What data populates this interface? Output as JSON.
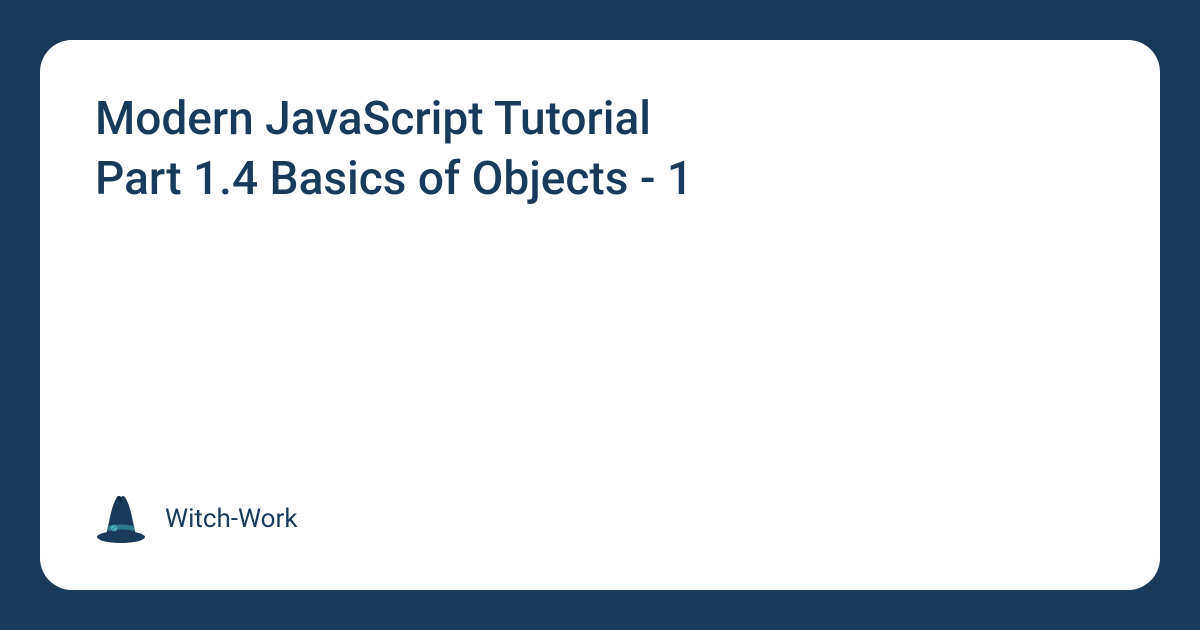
{
  "card": {
    "title": "Modern JavaScript Tutorial\nPart 1.4 Basics of Objects - 1",
    "brand": "Witch-Work"
  },
  "colors": {
    "background": "#1a3a5c",
    "card": "#ffffff",
    "text": "#1a3a5c"
  }
}
